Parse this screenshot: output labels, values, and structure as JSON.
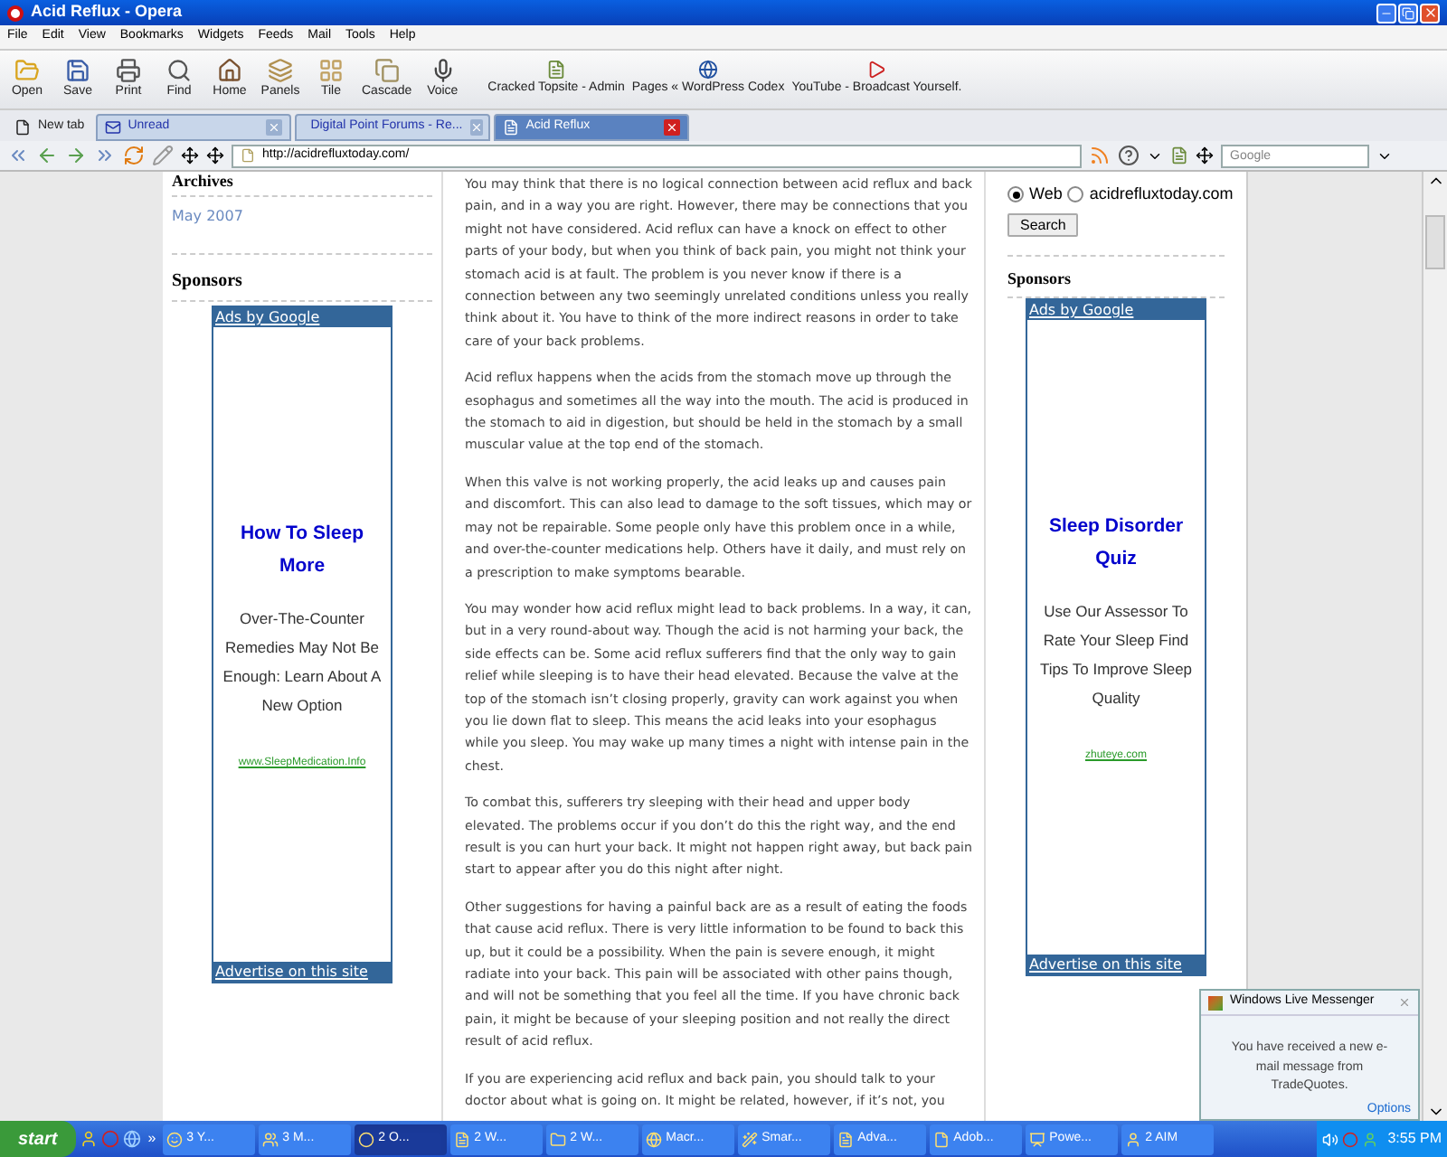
{
  "window": {
    "title": "Acid Reflux - Opera"
  },
  "menu": [
    "File",
    "Edit",
    "View",
    "Bookmarks",
    "Widgets",
    "Feeds",
    "Mail",
    "Tools",
    "Help"
  ],
  "toolbar": [
    {
      "label": "Open",
      "kind": "open"
    },
    {
      "label": "Save",
      "kind": "save"
    },
    {
      "label": "Print",
      "kind": "print"
    },
    {
      "label": "Find",
      "kind": "find"
    },
    {
      "label": "Home",
      "kind": "home"
    },
    {
      "label": "Panels",
      "kind": "panels"
    },
    {
      "label": "Tile",
      "kind": "tile"
    },
    {
      "label": "Cascade",
      "kind": "cascade"
    },
    {
      "label": "Voice",
      "kind": "voice"
    }
  ],
  "bookmarks": [
    {
      "label": "Cracked Topsite - Admin",
      "kind": "page"
    },
    {
      "label": "Pages « WordPress Codex",
      "kind": "globe"
    },
    {
      "label": "YouTube - Broadcast Yourself.",
      "kind": "video"
    }
  ],
  "tabs": [
    {
      "label": "New tab",
      "kind": "new",
      "selected": false
    },
    {
      "label": "Unread",
      "kind": "mail",
      "selected": false
    },
    {
      "label": "Digital Point Forums - Re...",
      "kind": "move",
      "selected": false
    },
    {
      "label": "Acid Reflux",
      "kind": "page",
      "selected": true
    }
  ],
  "address_bar": {
    "url": "http://acidrefluxtoday.com/",
    "search_placeholder": "Google"
  },
  "left_sidebar": {
    "archives_heading": "Archives",
    "archive_links": [
      "May 2007"
    ],
    "sponsors_heading": "Sponsors",
    "ad": {
      "header": "Ads by Google",
      "title": "How To Sleep More",
      "body": "Over-The-Counter Remedies May Not Be Enough: Learn About A New Option",
      "link": "www.SleepMedication.Info",
      "footer": "Advertise on this site"
    }
  },
  "article": {
    "paragraphs": [
      "You may think that there is no logical connection between acid reflux and back pain, and in a way you are right. However, there may be connections that you might not have considered. Acid reflux can have a knock on effect to other parts of your body, but when you think of back pain, you might not think your stomach acid is at fault. The problem is you never know if there is a connection between any two seemingly unrelated conditions unless you really think about it. You have to think of the more indirect reasons in order to take care of your back problems.",
      "Acid reflux happens when the acids from the stomach move up through the esophagus and sometimes all the way into the mouth. The acid is produced in the stomach to aid in digestion, but should be held in the stomach by a small muscular value at the top end of the stomach.",
      "When this valve is not working properly, the acid leaks up and causes pain and discomfort. This can also lead to damage to the soft tissues, which may or may not be repairable. Some people only have this problem once in a while, and over-the-counter medications help. Others have it daily, and must rely on a prescription to make symptoms bearable.",
      "You may wonder how acid reflux might lead to back problems. In a way, it can, but in a very round-about way. Though the acid is not harming your back, the side effects can be. Some acid reflux sufferers find that the only way to gain relief while sleeping is to have their head elevated. Because the valve at the top of the stomach isn’t closing properly, gravity can work against you when you lie down flat to sleep. This means the acid leaks into your esophagus while you sleep. You may wake up many times a night with intense pain in the chest.",
      "To combat this, sufferers try sleeping with their head and upper body elevated. The problems occur if you don’t do this the right way, and the end result is you can hurt your back. It might not happen right away, but back pain start to appear after you do this night after night.",
      "Other suggestions for having a painful back are as a result of eating the foods that cause acid reflux. There is very little information to be found to back this up, but it could be a possibility. When the pain is severe enough, it might radiate into your back. This pain will be associated with other pains though, and will not be something that you feel all the time. If you have chronic back pain, it might be because of your sleeping position and not really the direct result of acid reflux.",
      "If you are experiencing acid reflux and back pain, you should talk to your doctor about what is going on. It might be related, however, if it’s not, you"
    ]
  },
  "right_sidebar": {
    "search_options": [
      {
        "label": "Web",
        "selected": true
      },
      {
        "label": "acidrefluxtoday.com",
        "selected": false
      }
    ],
    "search_button": "Search",
    "sponsors_heading": "Sponsors",
    "ad": {
      "header": "Ads by Google",
      "title": "Sleep Disorder Quiz",
      "body": "Use Our Assessor To Rate Your Sleep Find Tips To Improve Sleep Quality",
      "link": "zhuteye.com",
      "footer": "Advertise on this site"
    }
  },
  "notification": {
    "title": "Windows Live Messenger",
    "message": "You have received a new e-mail message from TradeQuotes.",
    "link": "Options"
  },
  "taskbar": {
    "start": "start",
    "quick_launch_more": "»",
    "tasks": [
      {
        "label": "3 Y...",
        "kind": "smile",
        "selected": false
      },
      {
        "label": "3 M...",
        "kind": "users",
        "selected": false
      },
      {
        "label": "2 O...",
        "kind": "opera",
        "selected": true
      },
      {
        "label": "2 W...",
        "kind": "doc",
        "selected": false
      },
      {
        "label": "2 W...",
        "kind": "folder",
        "selected": false
      },
      {
        "label": "Macr...",
        "kind": "globe",
        "selected": false
      },
      {
        "label": "Smar...",
        "kind": "wand",
        "selected": false
      },
      {
        "label": "Adva...",
        "kind": "doc",
        "selected": false
      },
      {
        "label": "Adob...",
        "kind": "file",
        "selected": false
      },
      {
        "label": "Powe...",
        "kind": "slides",
        "selected": false
      },
      {
        "label": "2 AIM",
        "kind": "user",
        "selected": false
      }
    ],
    "clock": "3:55 PM"
  }
}
